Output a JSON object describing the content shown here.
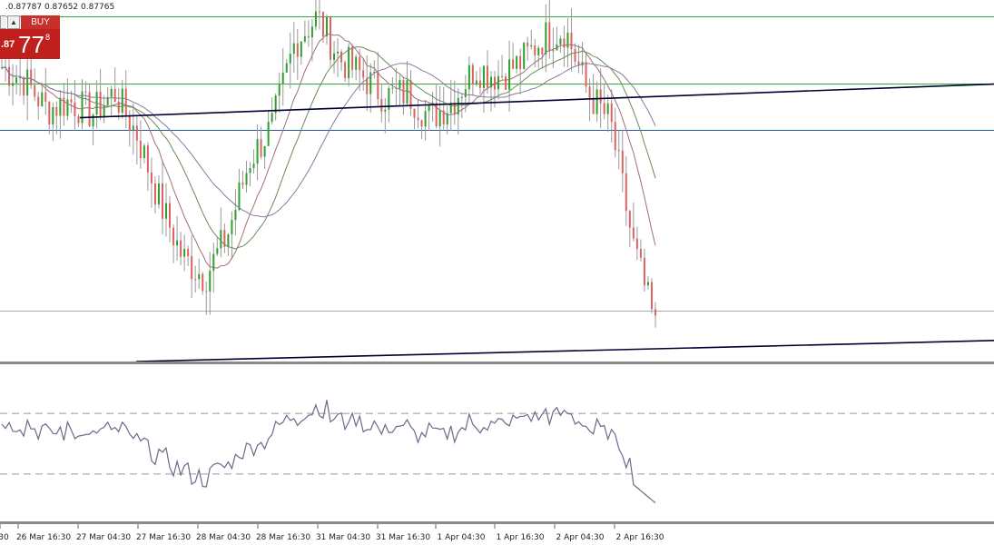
{
  "header": {
    "ohlc_text": ".0.87787 0.87652 0.87765"
  },
  "trade_panel": {
    "buy_label": "BUY",
    "price_small": ".87",
    "price_big": "77",
    "price_sup": "8",
    "arrow_symbol": "▲"
  },
  "colors": {
    "bull": "#2ca02c",
    "bear": "#e06060",
    "wick": "#999999",
    "ma_fast": "#a07070",
    "ma_mid": "#6a8c5a",
    "ma_slow": "#8a7aa0",
    "rsi": "#6a6a8a",
    "h_green": "#33aa33",
    "h_blue": "#1e5f9e",
    "h_gray": "#aaaaaa",
    "trend": "#000033"
  },
  "chart_data": {
    "type": "candlestick",
    "price_range": [
      0.8722,
      0.8808
    ],
    "x_tick_labels": [
      "30",
      "26 Mar 16:30",
      "27 Mar 04:30",
      "27 Mar 16:30",
      "28 Mar 04:30",
      "28 Mar 16:30",
      "31 Mar 04:30",
      "31 Mar 16:30",
      "1 Apr 04:30",
      "1 Apr 16:30",
      "2 Apr 04:30",
      "2 Apr 16:30"
    ],
    "candle_close_index": [
      0.8792,
      0.8789,
      0.8782,
      0.8784,
      0.8781,
      0.8786,
      0.8776,
      0.876,
      0.8747,
      0.8742,
      0.8752,
      0.877,
      0.8778,
      0.8798,
      0.8804,
      0.8794,
      0.879,
      0.8785,
      0.8786,
      0.878,
      0.8784,
      0.8792,
      0.879,
      0.8793,
      0.8799,
      0.8801,
      0.8786,
      0.8779,
      0.875,
      0.873
    ],
    "levels": {
      "green_top": 0.8804,
      "green_mid": 0.8788,
      "blue": 0.8777,
      "gray_low": 0.8734
    },
    "trendlines": [
      {
        "from": [
          "27 Mar 04:30",
          0.878
        ],
        "to": [
          "right-edge",
          0.8788
        ]
      },
      {
        "from": [
          "27 Mar 04:30",
          0.8727
        ],
        "to": [
          "right-edge",
          0.8733
        ]
      }
    ],
    "rsi_levels": [
      70,
      30
    ],
    "rsi_range": [
      0,
      100
    ]
  }
}
